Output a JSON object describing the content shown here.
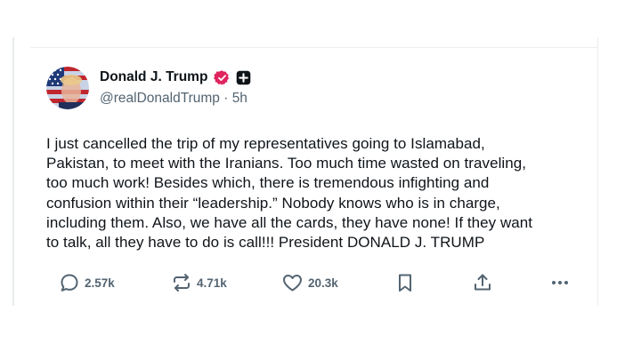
{
  "post": {
    "author": {
      "display_name": "Donald J. Trump",
      "handle": "@realDonaldTrump",
      "time": "5h"
    },
    "text": "I just cancelled the trip of my representatives going to Islamabad,\nPakistan, to meet with the Iranians. Too much time wasted on traveling,\ntoo much work! Besides which, there is tremendous infighting and\nconfusion within their “leadership.” Nobody knows who is in charge,\nincluding them. Also, we have all the cards, they have none! If they want\nto talk, all they have to do is call!!! President DONALD J. TRUMP",
    "stats": {
      "replies": "2.57k",
      "reposts": "4.71k",
      "likes": "20.3k"
    }
  },
  "colors": {
    "verified_badge": "#e0245e",
    "affiliation_badge": "#0f1419",
    "secondary_text": "#536471"
  },
  "icons": [
    "verified-badge-icon",
    "affiliation-badge-icon",
    "reply-icon",
    "repost-icon",
    "like-icon",
    "bookmark-icon",
    "share-icon",
    "more-icon"
  ]
}
